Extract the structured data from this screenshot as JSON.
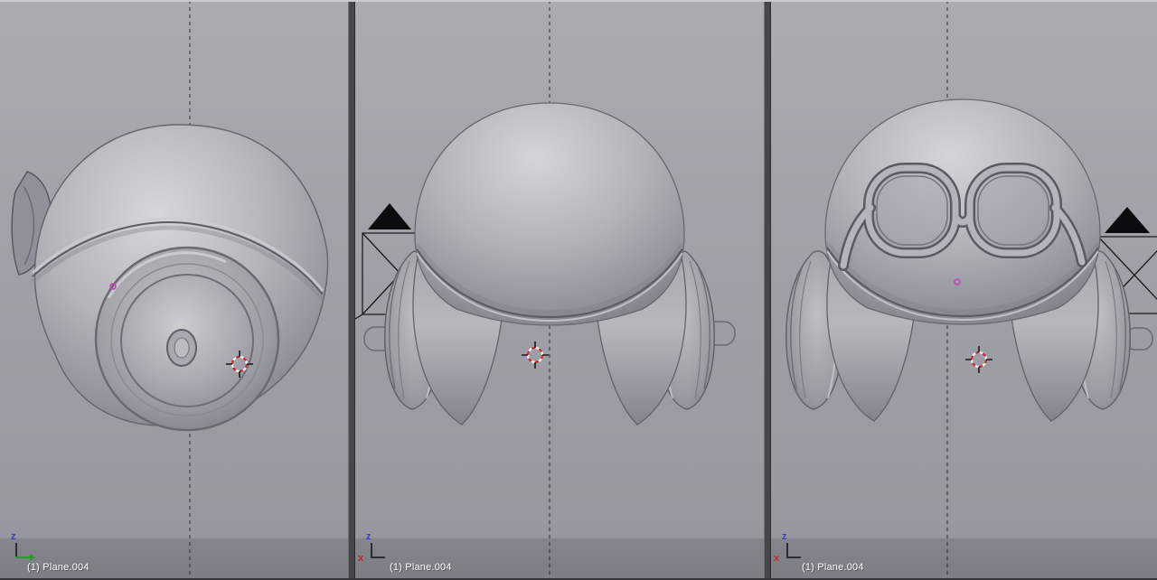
{
  "viewports": [
    {
      "label": "(1) Plane.004",
      "axis_letters": [
        "z"
      ]
    },
    {
      "label": "(1) Plane.004",
      "axis_letters": [
        "z",
        "x"
      ]
    },
    {
      "label": "(1) Plane.004",
      "axis_letters": [
        "z",
        "x"
      ]
    }
  ],
  "colors": {
    "viewport_bg": "#9fa0a7",
    "divider": "#46464b",
    "cursor_red": "#c23030",
    "object_center_magenta": "#c23ec2",
    "axis_z": "#3a3ace",
    "axis_x": "#cc2525",
    "axis_y": "#2f9b2f",
    "label_text": "#ffffff"
  }
}
